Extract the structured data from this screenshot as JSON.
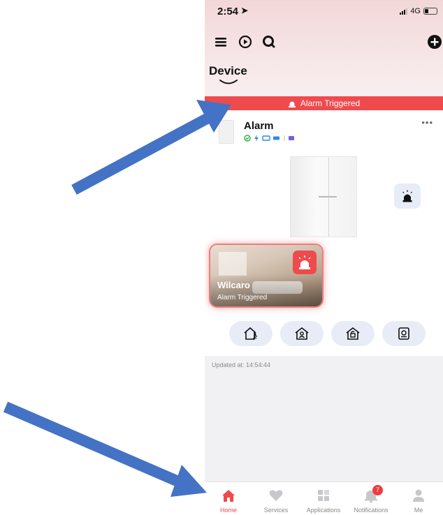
{
  "status_bar": {
    "time": "2:54",
    "network": "4G"
  },
  "page": {
    "title": "Device"
  },
  "alarm_banner": {
    "text": "Alarm Triggered"
  },
  "device": {
    "name": "Alarm",
    "more": "•••"
  },
  "scene": {
    "name": "Wilcaro",
    "status": "Alarm Triggered"
  },
  "modes": [
    {
      "icon": "away-arm-icon"
    },
    {
      "icon": "stay-arm-icon"
    },
    {
      "icon": "home-disarm-icon"
    },
    {
      "icon": "clear-alarm-icon"
    }
  ],
  "updated": {
    "text": "Updated at: 14:54:44"
  },
  "tabs": [
    {
      "label": "Home",
      "icon": "home-icon",
      "active": true
    },
    {
      "label": "Services",
      "icon": "heart-icon"
    },
    {
      "label": "Applications",
      "icon": "apps-icon"
    },
    {
      "label": "Notifications",
      "icon": "bell-icon",
      "badge": "7"
    },
    {
      "label": "Me",
      "icon": "person-icon"
    }
  ],
  "colors": {
    "alarm_red": "#ef4a4d",
    "arrow_blue": "#4472c4",
    "button_bg": "#e8ecf6"
  }
}
